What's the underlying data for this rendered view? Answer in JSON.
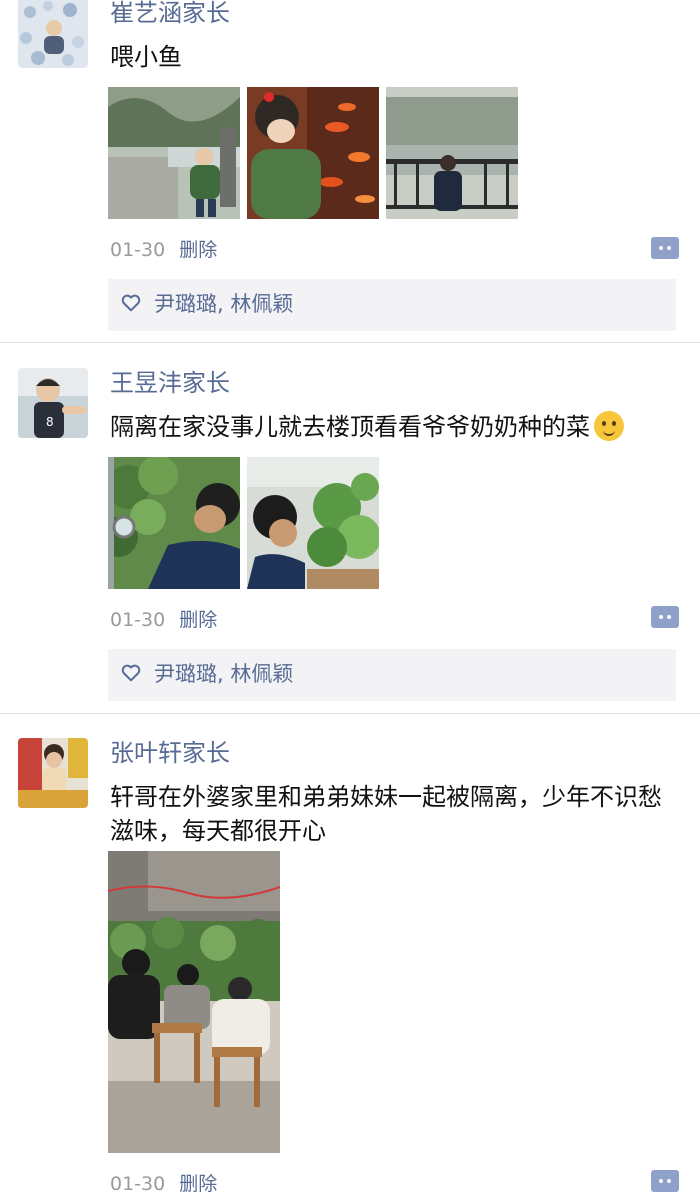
{
  "posts": [
    {
      "author": "崔艺涵家长",
      "text": "喂小鱼",
      "date": "01-30",
      "delete_label": "删除",
      "likes": "尹璐璐, 林佩颖",
      "photos": [
        "child-by-pond-photo",
        "child-feeding-fish-photo",
        "child-at-railing-photo"
      ]
    },
    {
      "author": "王昱沣家长",
      "text": "隔离在家没事儿就去楼顶看看爷爷奶奶种的菜",
      "emoji": "thinking-face-emoji",
      "date": "01-30",
      "delete_label": "删除",
      "likes": "尹璐璐, 林佩颖",
      "photos": [
        "boy-magnifier-vegetables-photo",
        "boy-looking-at-cabbage-photo"
      ]
    },
    {
      "author": "张叶轩家长",
      "text": "轩哥在外婆家里和弟弟妹妹一起被隔离，少年不识愁滋味，每天都很开心",
      "date": "01-30",
      "delete_label": "删除",
      "photos": [
        "kids-sitting-in-garden-photo"
      ]
    }
  ],
  "colors": {
    "name_link": "#576b95",
    "meta_gray": "#9a9a9a",
    "like_bg": "#f3f3f5",
    "more_button": "#8fa1c8",
    "divider": "#e3e3e3"
  }
}
